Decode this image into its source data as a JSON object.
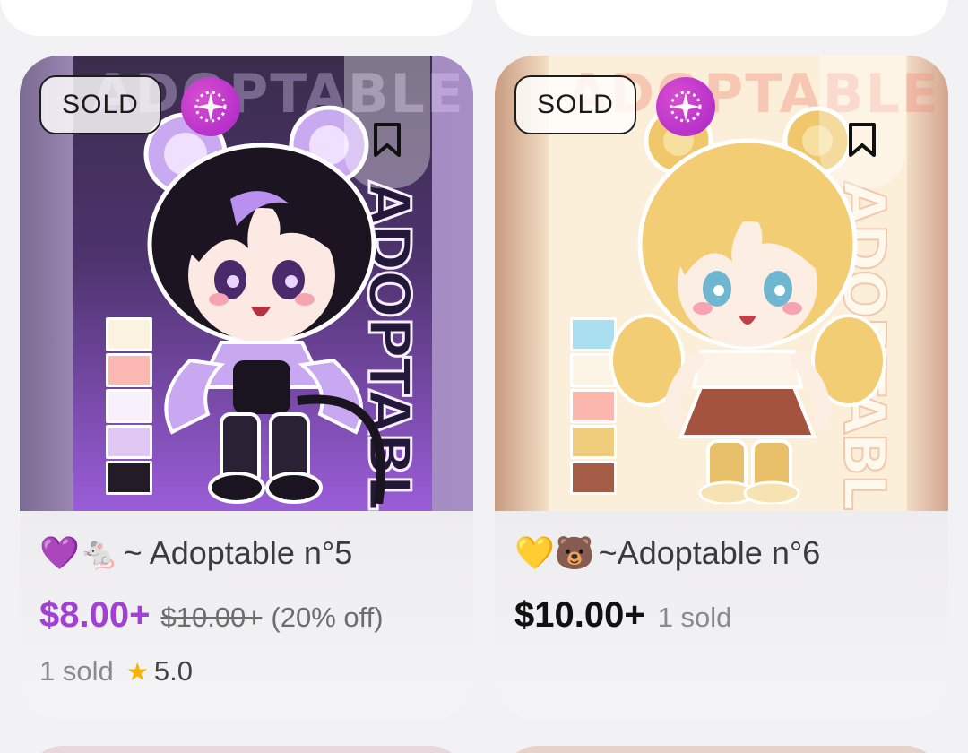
{
  "listings": [
    {
      "badge": "SOLD",
      "watermark": "ADOPTABLE",
      "vertical_text": "ADOPTABLE",
      "title_emoji": "💜🐁",
      "title_text": "~ Adoptable n°5",
      "price": "$8.00+",
      "original_price": "$10.00+",
      "discount": "(20% off)",
      "sold_count": "1 sold",
      "rating": "5.0",
      "swatch_colors": [
        "#fbf3df",
        "#fbb7b2",
        "#f8f1fb",
        "#e0c7f4",
        "#231c28"
      ],
      "accent_color": "#a23fd4"
    },
    {
      "badge": "SOLD",
      "watermark": "ADOPTABLE",
      "vertical_text": "ADOPTABLE",
      "title_emoji": "💛🐻",
      "title_text": "~Adoptable n°6",
      "price": "$10.00+",
      "sold_count": "1 sold",
      "swatch_colors": [
        "#a9dff0",
        "#fcf5e6",
        "#fbb7ae",
        "#efcd7d",
        "#a45c46"
      ],
      "accent_color": "#111111"
    }
  ]
}
